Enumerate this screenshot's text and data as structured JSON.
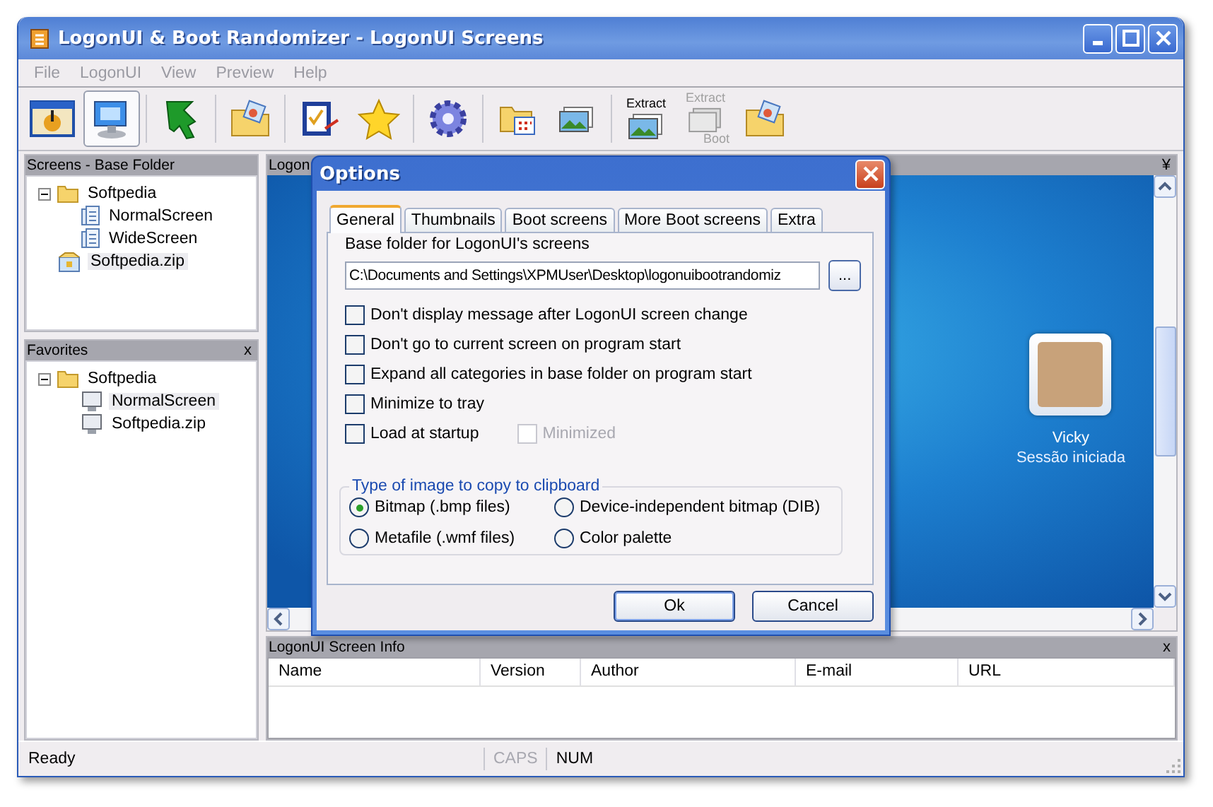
{
  "window": {
    "title": "LogonUI & Boot Randomizer - LogonUI Screens"
  },
  "menu": [
    {
      "label": "File",
      "disabled": true
    },
    {
      "label": "LogonUI",
      "disabled": true
    },
    {
      "label": "View",
      "disabled": true
    },
    {
      "label": "Preview",
      "disabled": true
    },
    {
      "label": "Help",
      "disabled": true
    }
  ],
  "toolbar": [
    {
      "kind": "button",
      "pressed": false
    },
    {
      "kind": "button",
      "pressed": true
    },
    {
      "kind": "separator"
    },
    {
      "kind": "button",
      "pressed": false
    },
    {
      "kind": "separator"
    },
    {
      "kind": "button",
      "pressed": false
    },
    {
      "kind": "separator"
    },
    {
      "kind": "button",
      "pressed": false
    },
    {
      "kind": "button",
      "pressed": false
    },
    {
      "kind": "separator"
    },
    {
      "kind": "button",
      "pressed": false
    },
    {
      "kind": "separator"
    },
    {
      "kind": "button",
      "pressed": false
    },
    {
      "kind": "button",
      "pressed": false
    },
    {
      "kind": "separator"
    },
    {
      "kind": "button",
      "pressed": false,
      "label": "Extract"
    },
    {
      "kind": "button",
      "pressed": false,
      "disabled": true,
      "label": "Extract",
      "sublabel": "Boot"
    },
    {
      "kind": "button",
      "pressed": false
    }
  ],
  "screens_panel": {
    "title": "Screens - Base Folder",
    "tree": [
      {
        "label": "Softpedia",
        "kind": "folder",
        "expanded": true,
        "selected": false,
        "children": [
          {
            "label": "NormalScreen",
            "kind": "screen",
            "selected": false
          },
          {
            "label": "WideScreen",
            "kind": "screen",
            "selected": false
          }
        ]
      },
      {
        "label": "Softpedia.zip",
        "kind": "archive",
        "selected": true
      }
    ]
  },
  "favorites_panel": {
    "title": "Favorites",
    "close": "x",
    "tree": [
      {
        "label": "Softpedia",
        "kind": "folder",
        "expanded": true,
        "selected": false,
        "children": [
          {
            "label": "NormalScreen",
            "kind": "monitor",
            "selected": true
          },
          {
            "label": "Softpedia.zip",
            "kind": "monitor",
            "selected": false
          }
        ]
      }
    ]
  },
  "preview_panel": {
    "title": "Logon",
    "menu": "¥",
    "user_name": "Vicky",
    "user_status": "Sessão iniciada"
  },
  "info_panel": {
    "title": "LogonUI Screen Info",
    "close": "x",
    "columns": [
      "Name",
      "Version",
      "Author",
      "E-mail",
      "URL"
    ]
  },
  "status_bar": {
    "text": "Ready",
    "indicators": [
      {
        "label": "CAPS",
        "on": false
      },
      {
        "label": "NUM",
        "on": true
      }
    ]
  },
  "dialog": {
    "title": "Options",
    "tabs": [
      {
        "label": "General",
        "selected": true
      },
      {
        "label": "Thumbnails",
        "selected": false
      },
      {
        "label": "Boot screens",
        "selected": false
      },
      {
        "label": "More Boot screens",
        "selected": false
      },
      {
        "label": "Extra",
        "selected": false
      }
    ],
    "folder_label": "Base folder for LogonUI's screens",
    "folder_value": "C:\\Documents and Settings\\XPMUser\\Desktop\\logonuibootrandomiz",
    "browse": "...",
    "options": [
      {
        "label": "Don't display message after LogonUI screen change",
        "checked": false,
        "disabled": false
      },
      {
        "label": "Don't go to current screen on program start",
        "checked": false,
        "disabled": false
      },
      {
        "label": "Expand all categories in base folder on program start",
        "checked": false,
        "disabled": false
      },
      {
        "label": "Minimize to tray",
        "checked": false,
        "disabled": false
      },
      {
        "label": "Load at startup",
        "checked": false,
        "disabled": false,
        "inline": {
          "label": "Minimized",
          "checked": false,
          "disabled": true
        }
      }
    ],
    "clipboard_group": {
      "title": "Type of image to copy to clipboard",
      "choices": [
        {
          "label": "Bitmap (.bmp files)",
          "selected": true
        },
        {
          "label": "Device-independent bitmap (DIB)",
          "selected": false
        },
        {
          "label": "Metafile (.wmf files)",
          "selected": false
        },
        {
          "label": "Color palette",
          "selected": false
        }
      ]
    },
    "buttons": [
      "Ok",
      "Cancel"
    ]
  }
}
